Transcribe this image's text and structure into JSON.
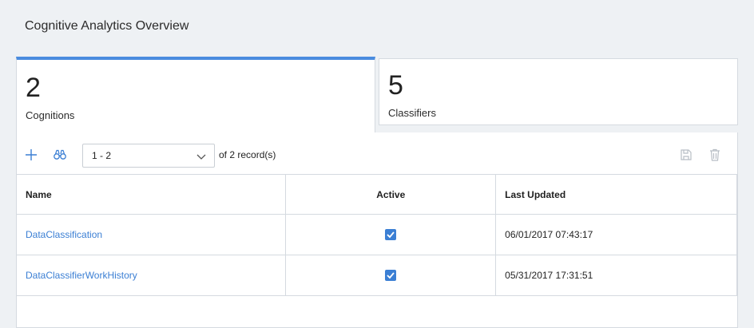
{
  "page": {
    "title": "Cognitive Analytics Overview"
  },
  "tabs": [
    {
      "count": "2",
      "label": "Cognitions",
      "active": true
    },
    {
      "count": "5",
      "label": "Classifiers",
      "active": false
    }
  ],
  "toolbar": {
    "pager_value": "1 - 2",
    "records_text": "of 2 record(s)",
    "icons": [
      "plus-icon",
      "binoculars-icon",
      "save-icon",
      "trash-icon"
    ]
  },
  "table": {
    "columns": [
      "Name",
      "Active",
      "Last Updated"
    ],
    "rows": [
      {
        "name": "DataClassification",
        "active": true,
        "last_updated": "06/01/2017 07:43:17"
      },
      {
        "name": "DataClassifierWorkHistory",
        "active": true,
        "last_updated": "05/31/2017 17:31:51"
      }
    ]
  },
  "colors": {
    "accent": "#4a8cdf",
    "link": "#3b7fd4",
    "background": "#eef1f4"
  }
}
